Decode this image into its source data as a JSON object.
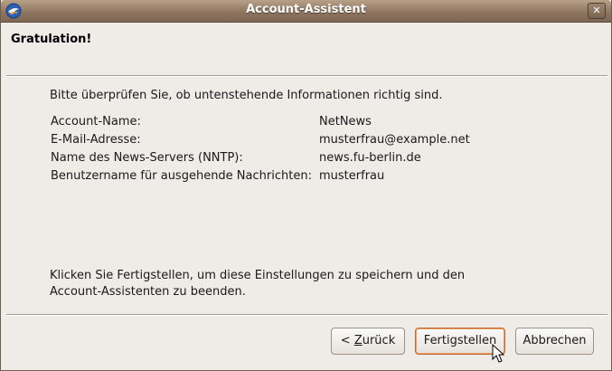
{
  "window": {
    "title": "Account-Assistent",
    "close_label": "✕"
  },
  "page": {
    "heading": "Gratulation!",
    "intro": "Bitte überprüfen Sie, ob untenstehende Informationen richtig sind.",
    "summary": [
      {
        "label": "Account-Name:",
        "value": "NetNews"
      },
      {
        "label": "E-Mail-Adresse:",
        "value": "musterfrau@example.net"
      },
      {
        "label": "Name des News-Servers (NNTP):",
        "value": "news.fu-berlin.de"
      },
      {
        "label": "Benutzername für ausgehende Nachrichten:",
        "value": "musterfrau"
      }
    ],
    "finish_text": "Klicken Sie Fertigstellen, um diese Einstellungen zu speichern und den Account-Assistenten zu beenden."
  },
  "buttons": {
    "back_prefix": "< ",
    "back_mnemonic": "Z",
    "back_rest": "urück",
    "finish": "Fertigstellen",
    "cancel": "Abbrechen"
  },
  "icons": {
    "app": "thunderbird-icon",
    "close": "close-icon",
    "cursor": "mouse-pointer-icon"
  }
}
